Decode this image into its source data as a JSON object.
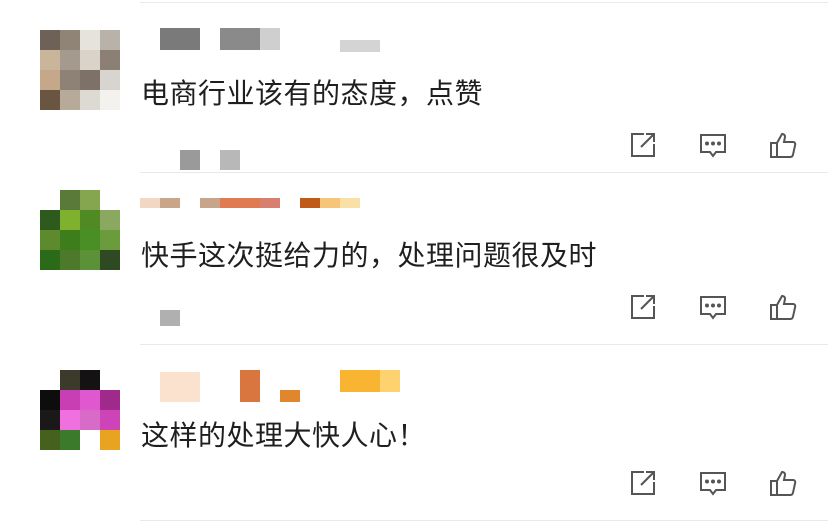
{
  "comments": [
    {
      "text": "电商行业该有的态度，点赞",
      "avatar": [
        "#6e6258",
        "#8f8476",
        "#e6e2dc",
        "#b9b2a8",
        "#c8b59a",
        "#a49a8e",
        "#d9d3c9",
        "#8b8073",
        "#c5a88a",
        "#8e8175",
        "#7d7168",
        "#d8d4cf",
        "#6a5442",
        "#b7aa99",
        "#ddd9d3",
        "#f4f2ef"
      ]
    },
    {
      "text": "快手这次挺给力的，处理问题很及时",
      "avatar": [
        "#ffffff",
        "#5a7a3a",
        "#86a54f",
        "#ffffff",
        "#2f5a1e",
        "#7fb12e",
        "#4f8a22",
        "#8aa860",
        "#5d8a2d",
        "#3d7d1c",
        "#4a8f26",
        "#6a9b3c",
        "#2b6a18",
        "#4d7a2a",
        "#5b9238",
        "#2f4a22"
      ]
    },
    {
      "text": "这样的处理大快人心！",
      "avatar": [
        "#ffffff",
        "#3c3a2a",
        "#141212",
        "#ffffff",
        "#0e0d0d",
        "#c83fb4",
        "#e058d0",
        "#a0298c",
        "#1a1818",
        "#f070e0",
        "#d86ac8",
        "#cc44b8",
        "#46601e",
        "#3a7a2a",
        "#ffffff",
        "#e8a420"
      ]
    }
  ],
  "actions": {
    "share_icon": "share-icon",
    "reply_icon": "reply-icon",
    "like_icon": "thumbs-up-icon"
  }
}
